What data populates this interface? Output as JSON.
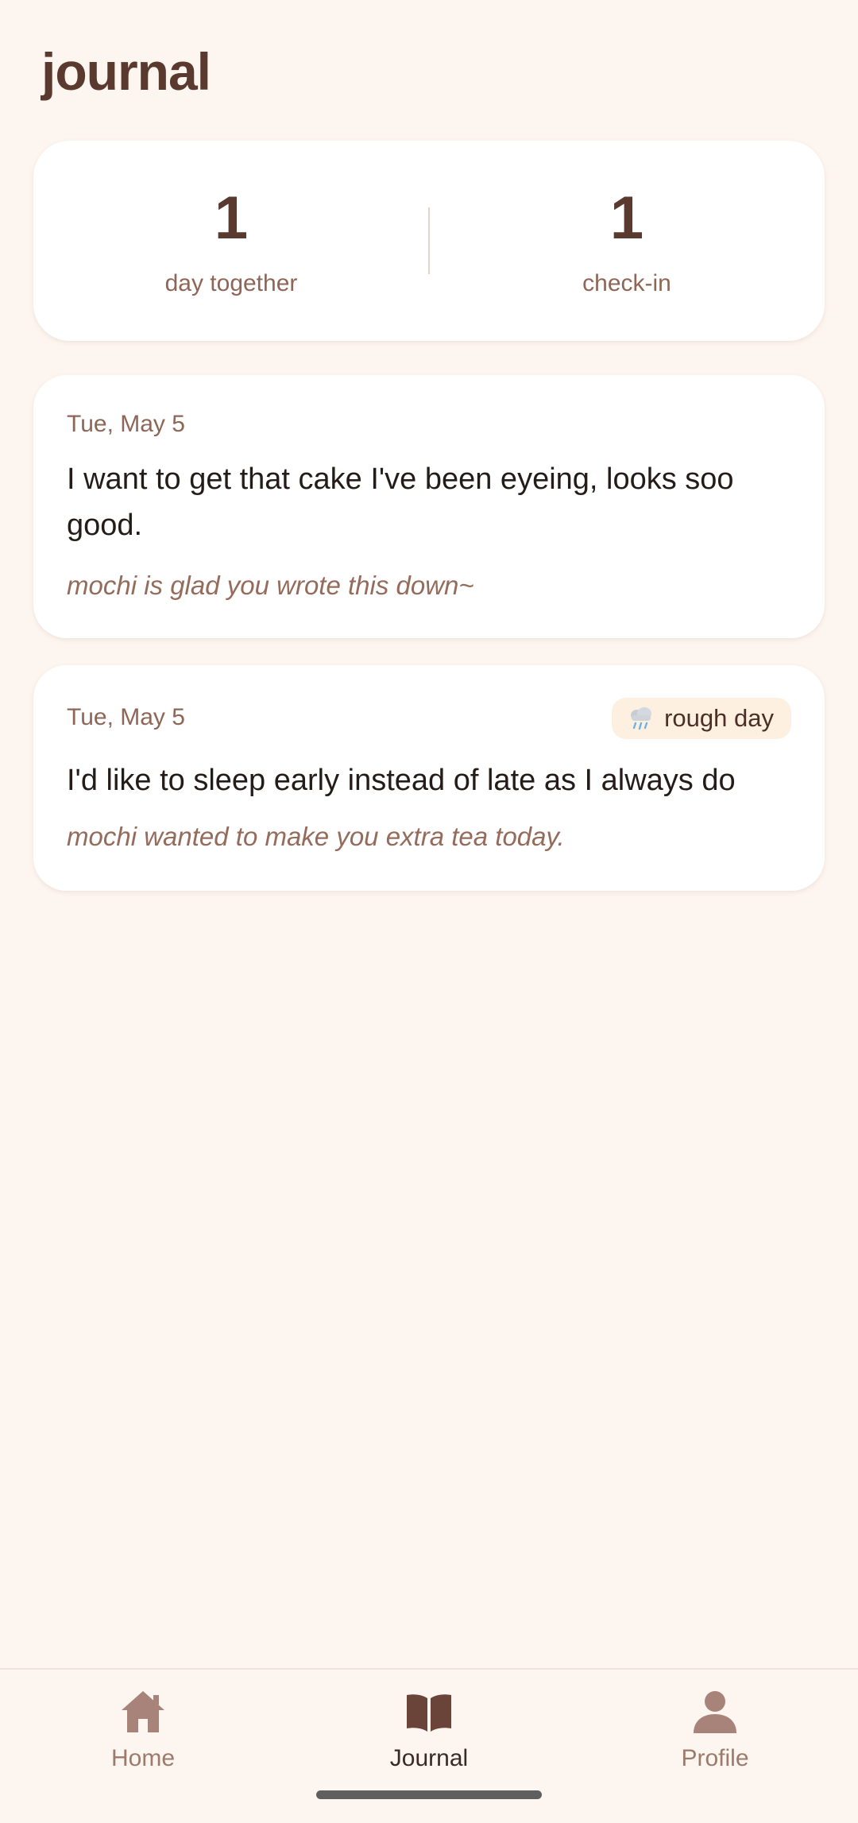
{
  "page": {
    "title": "journal"
  },
  "stats": {
    "days_value": "1",
    "days_label": "day together",
    "checkins_value": "1",
    "checkins_label": "check-in"
  },
  "entries": [
    {
      "date": "Tue, May 5",
      "text": "I want to get that cake I've been eyeing, looks soo good.",
      "note": "mochi is glad you wrote this down~"
    },
    {
      "date": "Tue, May 5",
      "mood_icon": "rain-cloud-icon",
      "mood_label": "rough day",
      "text": "I'd like to sleep early instead of late as I always do",
      "note": "mochi wanted to make you extra tea today."
    }
  ],
  "nav": {
    "items": [
      {
        "label": "Home",
        "icon": "home-icon"
      },
      {
        "label": "Journal",
        "icon": "book-icon",
        "active": true
      },
      {
        "label": "Profile",
        "icon": "person-icon"
      }
    ]
  },
  "colors": {
    "background": "#fdf5ef",
    "card": "#ffffff",
    "accent_brown": "#5a3a2e",
    "muted_brown": "#8e6657",
    "badge_bg": "#fdf0e0"
  }
}
